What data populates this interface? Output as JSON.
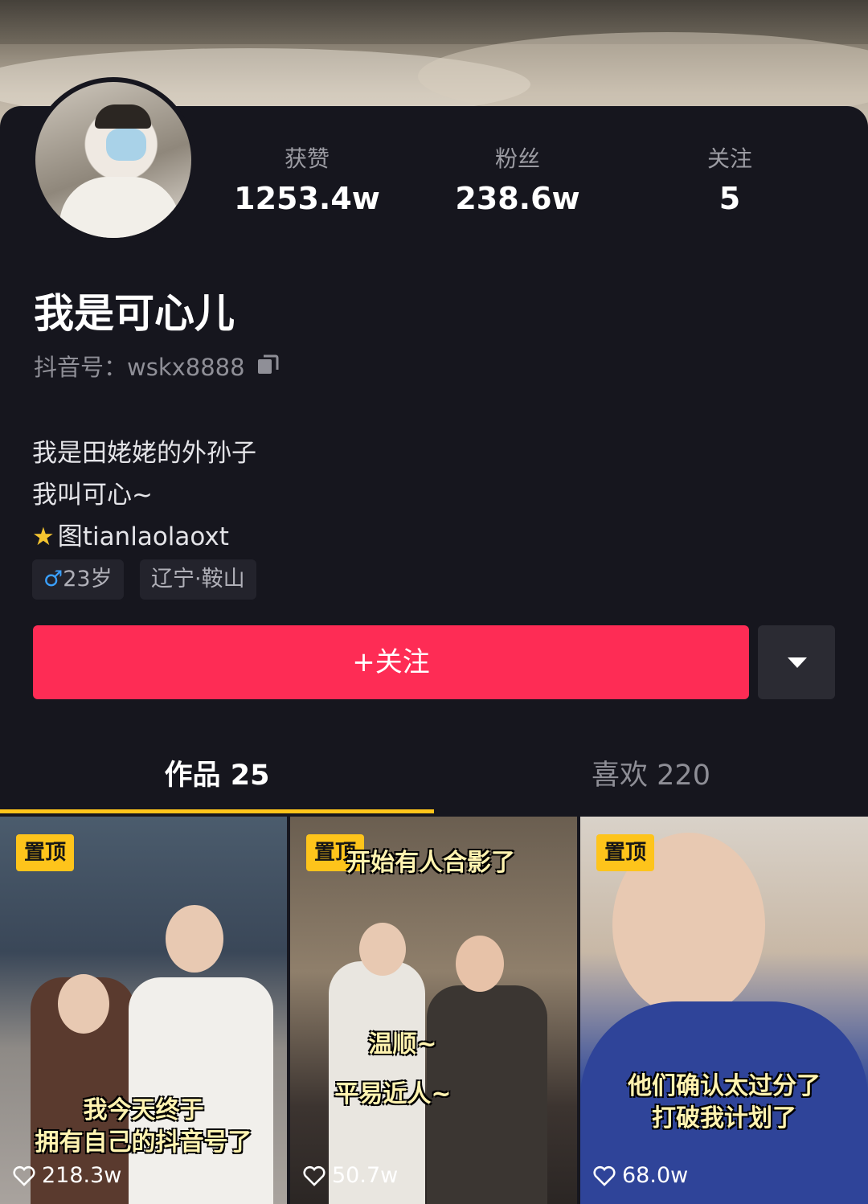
{
  "profile": {
    "name": "我是可心儿",
    "douyin_id": "抖音号：wskx8888",
    "stats": [
      {
        "label": "获赞",
        "value": "1253.4w"
      },
      {
        "label": "粉丝",
        "value": "238.6w"
      },
      {
        "label": "关注",
        "value": "5"
      }
    ],
    "bio": [
      "我是田姥姥的外孙子",
      "我叫可心~",
      "图tianlaolaoxt"
    ],
    "bio_icon": "star-emoji",
    "tags": {
      "gender_symbol": "♂",
      "age": "23岁",
      "location": "辽宁·鞍山"
    },
    "gender_color": "#3aa0ff"
  },
  "actions": {
    "follow_label": "+关注",
    "more_icon": "triangle-down-icon"
  },
  "tabs": [
    {
      "label": "作品 25",
      "active": true
    },
    {
      "label": "喜欢 220",
      "active": false
    }
  ],
  "videos": [
    {
      "pin": "置顶",
      "caption_lines": [
        "我今天终于",
        "拥有自己的抖音号了"
      ],
      "likes": "218.3w"
    },
    {
      "pin": "置顶",
      "caption_top": "开始有人合影了",
      "caption_lines": [
        "温顺~",
        "平易近人~"
      ],
      "likes": "50.7w"
    },
    {
      "pin": "置顶",
      "caption_lines": [
        "他们确认太过分了",
        "打破我计划了"
      ],
      "likes": "68.0w"
    }
  ],
  "colors": {
    "accent": "#fe2c55",
    "pin": "#fec41b",
    "background": "#16161e"
  }
}
